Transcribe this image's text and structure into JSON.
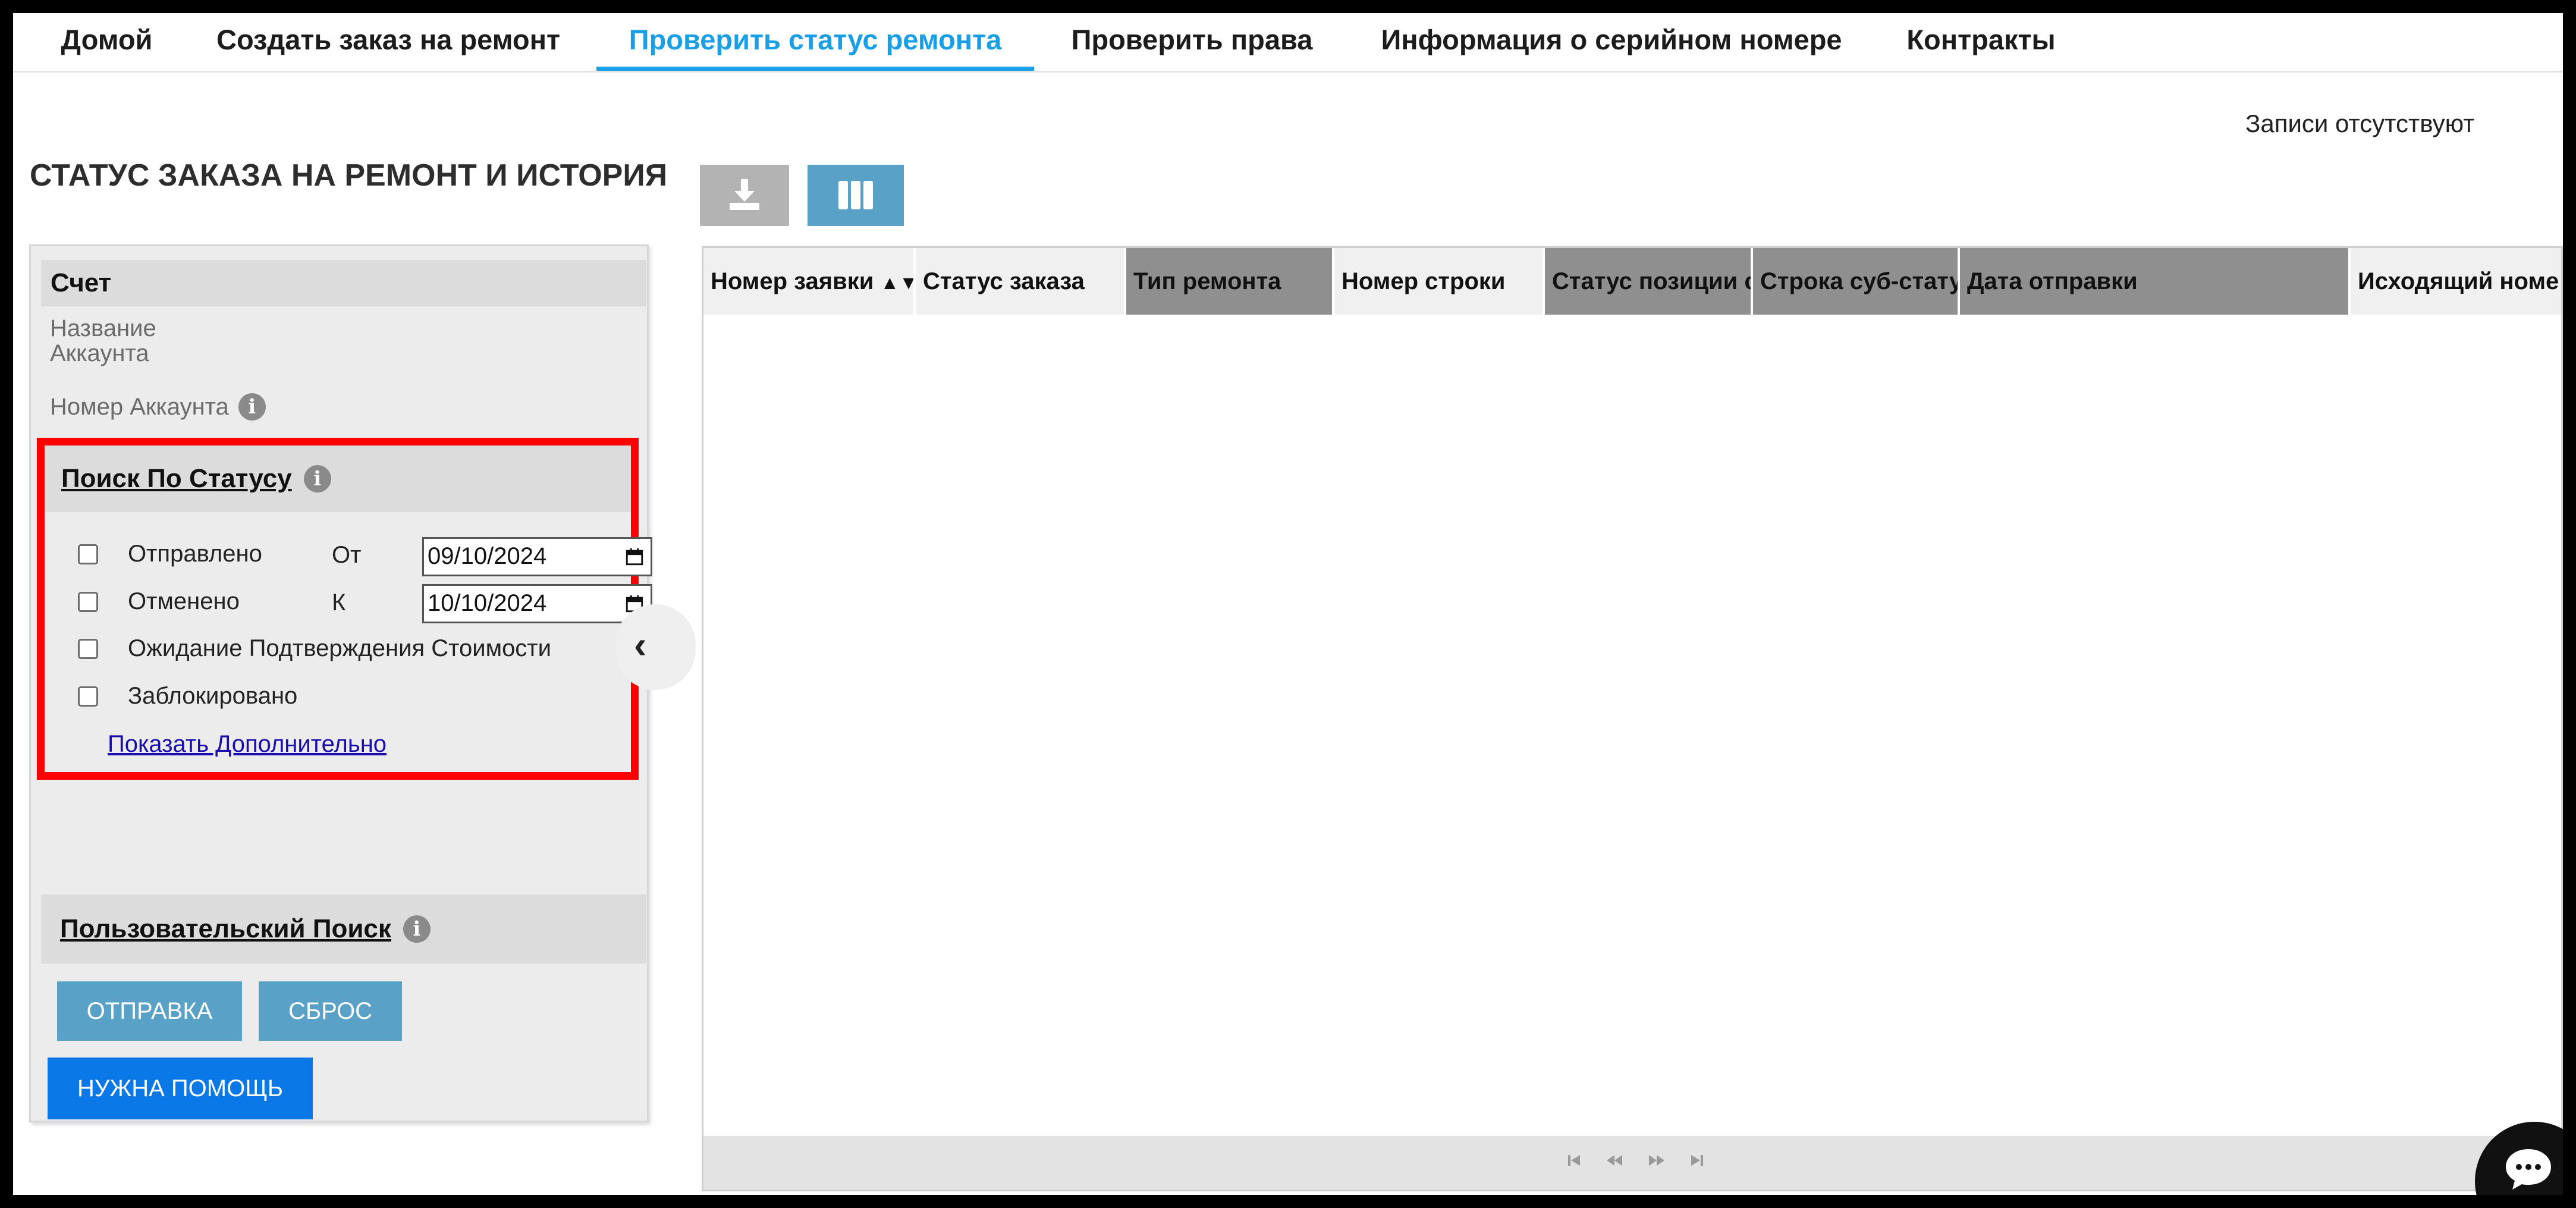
{
  "nav": {
    "tabs": [
      {
        "label": "Домой"
      },
      {
        "label": "Создать заказ на ремонт"
      },
      {
        "label": "Проверить статус ремонта"
      },
      {
        "label": "Проверить права"
      },
      {
        "label": "Информация о серийном номере"
      },
      {
        "label": "Контракты"
      }
    ]
  },
  "page": {
    "title": "СТАТУС ЗАКАЗА НА РЕМОНТ И ИСТОРИЯ",
    "records_status": "Записи отсутствуют"
  },
  "account": {
    "header": "Счет",
    "name_label": "Название Аккаунта",
    "number_label": "Номер Аккаунта"
  },
  "status_search": {
    "title": "Поиск По Статусу",
    "statuses": [
      {
        "label": "Отправлено",
        "checked": false
      },
      {
        "label": "Отменено",
        "checked": false
      },
      {
        "label": "Ожидание Подтверждения Стоимости",
        "checked": false
      },
      {
        "label": "Заблокировано",
        "checked": false
      }
    ],
    "from_label": "От",
    "from_value": "09/10/2024",
    "to_label": "К",
    "to_value": "10/10/2024",
    "show_more": "Показать Дополнительно"
  },
  "custom_search": {
    "title": "Пользовательский Поиск"
  },
  "buttons": {
    "submit": "ОТПРАВКА",
    "reset": "СБРОС",
    "help": "НУЖНА ПОМОЩЬ"
  },
  "grid": {
    "columns": [
      {
        "label": "Номер заявки"
      },
      {
        "label": "Статус заказа"
      },
      {
        "label": "Тип ремонта"
      },
      {
        "label": "Номер строки"
      },
      {
        "label": "Статус позиции ст"
      },
      {
        "label": "Строка суб-статуса"
      },
      {
        "label": "Дата отправки"
      },
      {
        "label": "Исходящий номе"
      }
    ]
  },
  "colors": {
    "accent": "#1a9ee6",
    "button": "#5aa1c8",
    "help_button": "#0a78e6",
    "highlight": "#ff0000"
  }
}
